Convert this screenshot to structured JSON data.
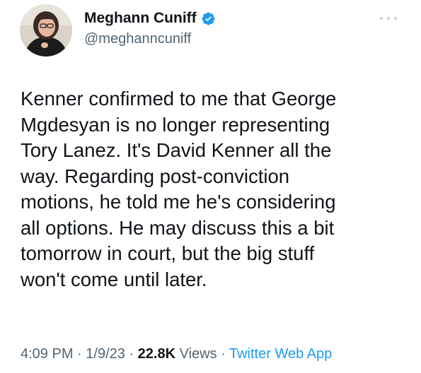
{
  "author": {
    "display_name": "Meghann Cuniff",
    "handle": "@meghanncuniff",
    "verified_icon": "verified-badge-icon",
    "avatar_icon": "avatar-photo"
  },
  "tweet": {
    "lines": [
      "Kenner confirmed to me that George",
      "Mgdesyan is no longer representing",
      "Tory Lanez. It's David Kenner all the",
      "way. Regarding post-conviction",
      "motions, he told me he's considering",
      "all options. He may discuss this a bit",
      "tomorrow in court, but the big stuff",
      "won't come until later."
    ]
  },
  "meta": {
    "time": "4:09 PM",
    "sep1": " · ",
    "date": "1/9/23",
    "sep2": " · ",
    "views_count": "22.8K",
    "views_label": " Views",
    "sep3": " · ",
    "source": "Twitter Web App"
  },
  "colors": {
    "accent": "#1d9bf0",
    "text": "#0f1419",
    "muted": "#536471"
  },
  "more_icon": "more-options-icon"
}
